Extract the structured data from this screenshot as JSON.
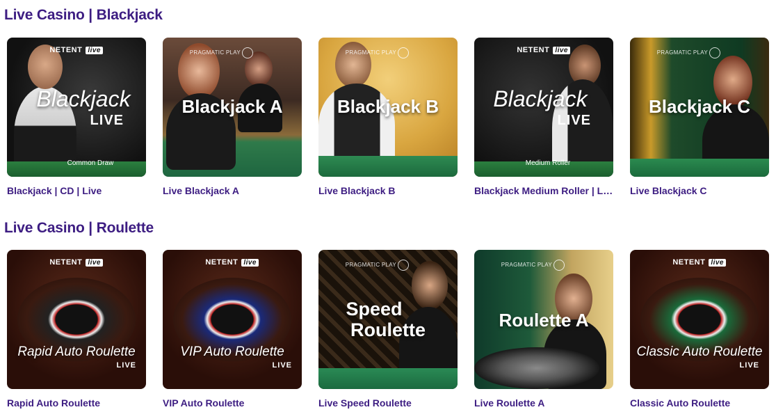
{
  "sections": [
    {
      "title": "Live Casino | Blackjack",
      "games": [
        {
          "label": "Blackjack | CD | Live",
          "thumb_title": "Blackjack",
          "thumb_live": "LIVE",
          "thumb_sub": "Common Draw",
          "provider": "NETENT",
          "provider_badge": "live"
        },
        {
          "label": "Live Blackjack A",
          "thumb_title": "Blackjack A",
          "provider": "PRAGMATIC PLAY"
        },
        {
          "label": "Live Blackjack B",
          "thumb_title": "Blackjack B",
          "provider": "PRAGMATIC PLAY"
        },
        {
          "label": "Blackjack Medium Roller | Live",
          "thumb_title": "Blackjack",
          "thumb_live": "LIVE",
          "thumb_sub": "Medium Roller",
          "provider": "NETENT",
          "provider_badge": "live"
        },
        {
          "label": "Live Blackjack C",
          "thumb_title": "Blackjack C",
          "provider": "PRAGMATIC PLAY"
        }
      ]
    },
    {
      "title": "Live Casino | Roulette",
      "games": [
        {
          "label": "Rapid Auto Roulette",
          "thumb_title": "Rapid Auto Roulette",
          "thumb_live": "LIVE",
          "provider": "NETENT",
          "provider_badge": "live"
        },
        {
          "label": "VIP Auto Roulette",
          "thumb_title": "VIP Auto Roulette",
          "thumb_live": "LIVE",
          "provider": "NETENT",
          "provider_badge": "live"
        },
        {
          "label": "Live Speed Roulette",
          "thumb_title": "Speed",
          "thumb_title2": "Roulette",
          "provider": "PRAGMATIC PLAY"
        },
        {
          "label": "Live Roulette A",
          "thumb_title": "Roulette A",
          "provider": "PRAGMATIC PLAY"
        },
        {
          "label": "Classic Auto Roulette",
          "thumb_title": "Classic Auto Roulette",
          "thumb_live": "LIVE",
          "provider": "NETENT",
          "provider_badge": "live"
        }
      ]
    }
  ],
  "colors": {
    "heading": "#3d1d82",
    "felt": "#1f7a46",
    "dark": "#141414"
  }
}
